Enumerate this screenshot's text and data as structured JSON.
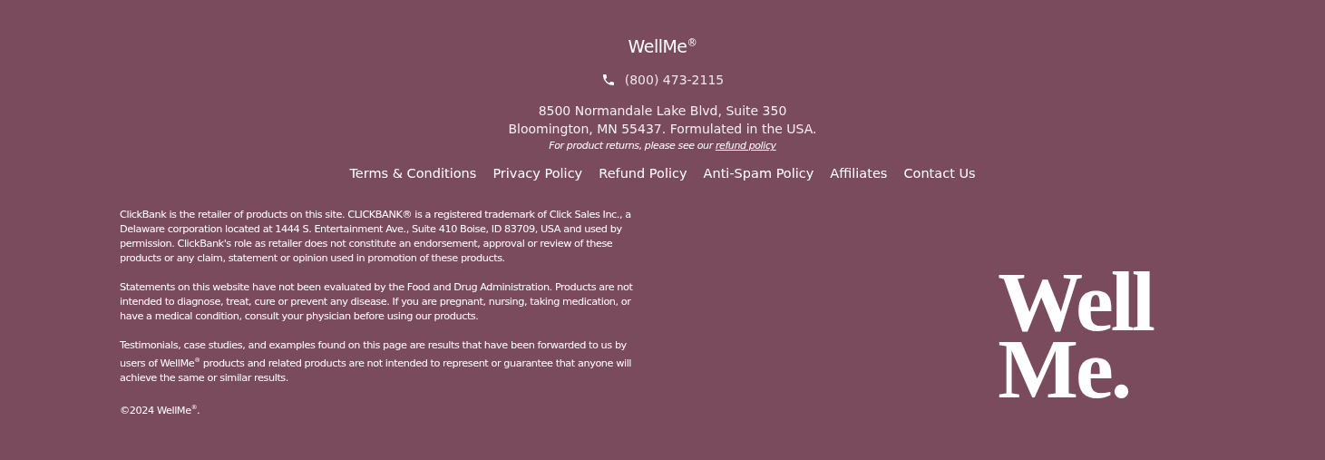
{
  "brand": "WellMe$^{®}$",
  "phone": "(800) 473-2115",
  "address": [
    "8500 Normandale Lake Blvd, Suite 350",
    "Bloomington, MN 55437. Formulated in the USA."
  ],
  "returns_note": {
    "text": "For product returns, please see our",
    "link": "refund policy"
  },
  "nav_links": [
    "Terms & Conditions",
    "Privacy Policy",
    "Refund Policy",
    "Anti-Spam Policy",
    "Affiliates",
    "Contact Us"
  ],
  "disclaimers": [
    "ClickBank is the retailer of products on this site. CLICKBANK® is a registered trademark of Click Sales Inc., a Delaware corporation located at 1444 S. Entertainment Ave., Suite 410 Boise, ID 83709, USA and used by permission. ClickBank's role as retailer does not constitute an endorsement, approval or review of these products or any claim, statement or opinion used in promotion of these products.",
    "Statements on this website have not been evaluated by the Food and Drug Administration. Products are not intended to diagnose, treat, cure or prevent any disease. If you are pregnant, nursing, taking medication, or have a medical condition, consult your physician before using our products.",
    "Testimonials, case studies, and examples found on this page are results that have been forwarded to us by users of WellMe$^{®}$ products and related products are not intended to represent or guarantee that anyone will achieve the same or similar results.",
    "©2024 WellMe$^{®}$."
  ],
  "logo": [
    "Well",
    "Me."
  ]
}
